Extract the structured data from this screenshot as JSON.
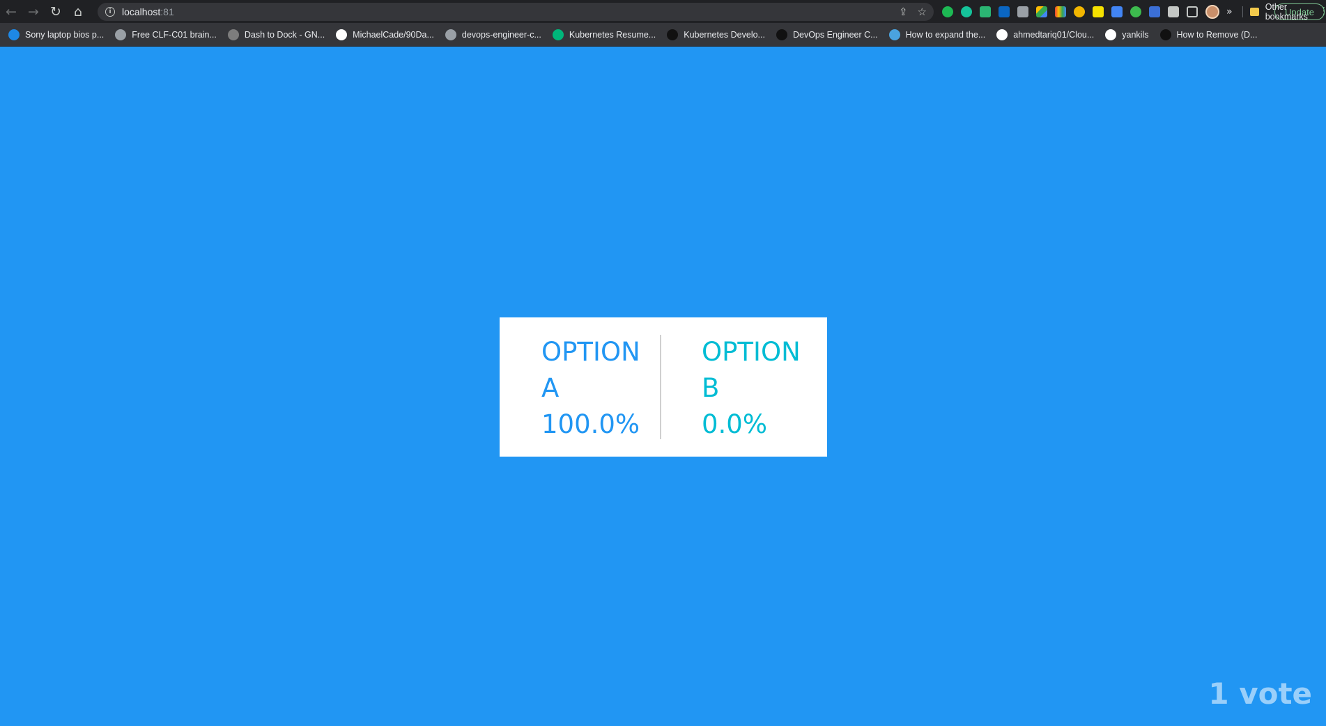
{
  "browser": {
    "url_host": "localhost",
    "url_port": ":81",
    "update_label": "Update"
  },
  "bookmarks": [
    {
      "label": "Sony laptop bios p...",
      "icon": "lock-icon",
      "color": "#1e88e5"
    },
    {
      "label": "Free CLF-C01 brain...",
      "icon": "globe-icon",
      "color": "#9aa0a6"
    },
    {
      "label": "Dash to Dock - GN...",
      "icon": "gnome-icon",
      "color": "#7d7d7d"
    },
    {
      "label": "MichaelCade/90Da...",
      "icon": "github-icon",
      "color": "#ffffff"
    },
    {
      "label": "devops-engineer-c...",
      "icon": "globe-icon",
      "color": "#9aa0a6"
    },
    {
      "label": "Kubernetes Resume...",
      "icon": "c-icon",
      "color": "#00b67a"
    },
    {
      "label": "Kubernetes Develo...",
      "icon": "seven-icon",
      "color": "#111111"
    },
    {
      "label": "DevOps Engineer C...",
      "icon": "v-icon",
      "color": "#111111"
    },
    {
      "label": "How to expand the...",
      "icon": "cloud-icon",
      "color": "#4aa3df"
    },
    {
      "label": "ahmedtariq01/Clou...",
      "icon": "github-icon",
      "color": "#ffffff"
    },
    {
      "label": "yankils",
      "icon": "github-icon",
      "color": "#ffffff"
    },
    {
      "label": "How to Remove (D...",
      "icon": "hex-icon",
      "color": "#111111"
    }
  ],
  "bookmarks_overflow": "»",
  "other_bookmarks": "Other bookmarks",
  "results": {
    "option_a": {
      "label_line1": "OPTION",
      "label_line2": "A",
      "percent": "100.0%",
      "color": "#2196f3"
    },
    "option_b": {
      "label_line1": "OPTION",
      "label_line2": "B",
      "percent": "0.0%",
      "color": "#00bcd4"
    },
    "vote_count": "1 vote"
  },
  "page_background": "#2196f3"
}
